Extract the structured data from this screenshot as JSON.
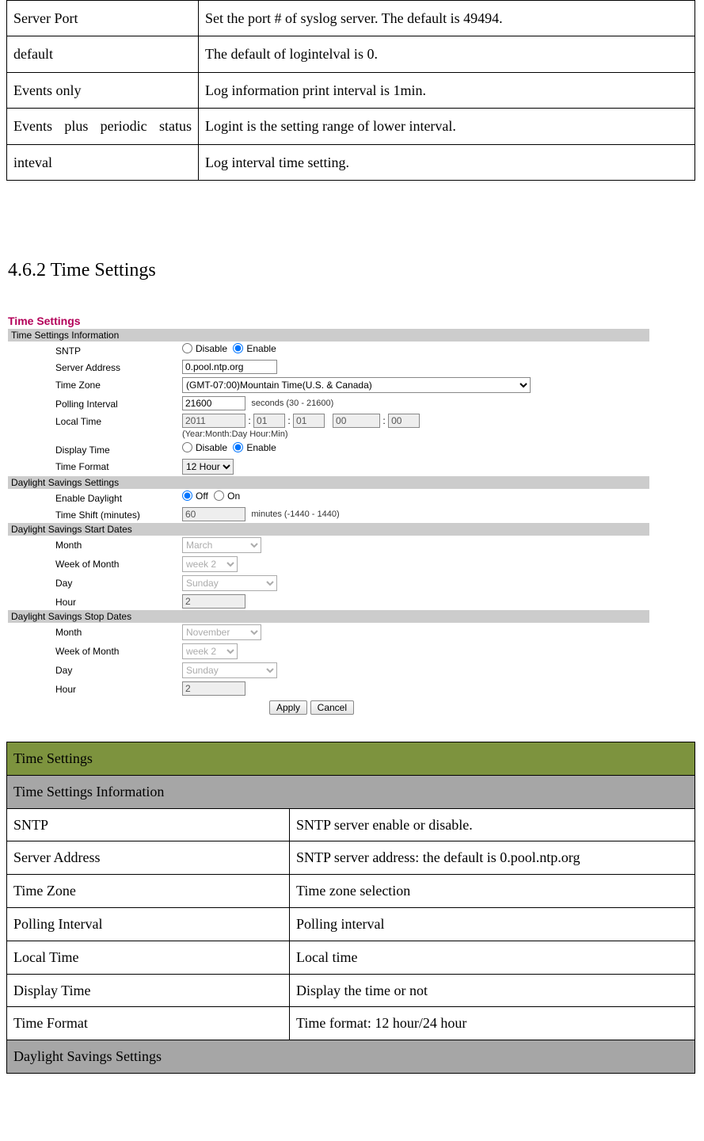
{
  "topTable": {
    "rows": [
      {
        "c1": "Server Port",
        "c2": "Set the port # of syslog server. The default is 49494."
      },
      {
        "c1": "default",
        "c2": "The default of logintelval is 0."
      },
      {
        "c1": "Events only",
        "c2": "Log information print interval is 1min."
      },
      {
        "c1": "Events plus periodic status",
        "c2": "Logint is the setting range of lower interval."
      },
      {
        "c1": "inteval",
        "c2": "Log interval time setting."
      }
    ]
  },
  "sectionTitle": "4.6.2 Time Settings",
  "screenshot": {
    "title": "Time Settings",
    "groups": {
      "info": {
        "header": "Time Settings Information",
        "sntp": {
          "label": "SNTP",
          "opt1": "Disable",
          "opt2": "Enable",
          "selected": "Enable"
        },
        "server": {
          "label": "Server Address",
          "value": "0.pool.ntp.org"
        },
        "tz": {
          "label": "Time Zone",
          "value": "(GMT-07:00)Mountain Time(U.S. & Canada)"
        },
        "poll": {
          "label": "Polling Interval",
          "value": "21600",
          "hint": "seconds (30 - 21600)"
        },
        "local": {
          "label": "Local Time",
          "year": "2011",
          "mon": "01",
          "day": "01",
          "hour": "00",
          "min": "00",
          "hint": "(Year:Month:Day Hour:Min)"
        },
        "disp": {
          "label": "Display Time",
          "opt1": "Disable",
          "opt2": "Enable",
          "selected": "Enable"
        },
        "fmt": {
          "label": "Time Format",
          "value": "12 Hour"
        }
      },
      "dst": {
        "header": "Daylight Savings Settings",
        "enable": {
          "label": "Enable Daylight",
          "opt1": "Off",
          "opt2": "On",
          "selected": "Off"
        },
        "shift": {
          "label": "Time Shift (minutes)",
          "value": "60",
          "hint": "minutes (-1440 - 1440)"
        }
      },
      "start": {
        "header": "Daylight Savings Start Dates",
        "month": {
          "label": "Month",
          "value": "March"
        },
        "week": {
          "label": "Week of Month",
          "value": "week 2"
        },
        "day": {
          "label": "Day",
          "value": "Sunday"
        },
        "hour": {
          "label": "Hour",
          "value": "2"
        }
      },
      "stop": {
        "header": "Daylight Savings Stop Dates",
        "month": {
          "label": "Month",
          "value": "November"
        },
        "week": {
          "label": "Week of Month",
          "value": "week 2"
        },
        "day": {
          "label": "Day",
          "value": "Sunday"
        },
        "hour": {
          "label": "Hour",
          "value": "2"
        }
      }
    },
    "buttons": {
      "apply": "Apply",
      "cancel": "Cancel"
    }
  },
  "descTable": {
    "title": "Time Settings",
    "h1": "Time Settings Information",
    "rows1": [
      {
        "c1": "SNTP",
        "c2": "SNTP server enable or disable."
      },
      {
        "c1": "Server Address",
        "c2": "SNTP server address: the default is 0.pool.ntp.org"
      },
      {
        "c1": "Time Zone",
        "c2": "Time zone selection"
      },
      {
        "c1": "Polling Interval",
        "c2": "Polling interval"
      },
      {
        "c1": "Local Time",
        "c2": "Local time"
      },
      {
        "c1": "Display Time",
        "c2": "Display the time or not"
      },
      {
        "c1": "Time Format",
        "c2": "Time format: 12 hour/24 hour"
      }
    ],
    "h2": "Daylight Savings Settings"
  }
}
